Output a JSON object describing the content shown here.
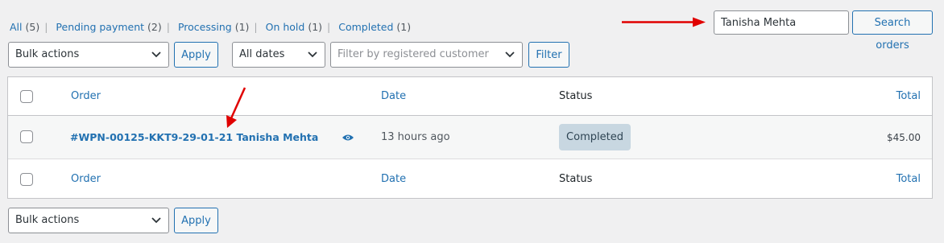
{
  "status_filters": [
    {
      "label": "All",
      "count": "(5)"
    },
    {
      "label": "Pending payment",
      "count": "(2)"
    },
    {
      "label": "Processing",
      "count": "(1)"
    },
    {
      "label": "On hold",
      "count": "(1)"
    },
    {
      "label": "Completed",
      "count": "(1)"
    }
  ],
  "search": {
    "value": "Tanisha Mehta",
    "button_label": "Search orders"
  },
  "top_actions": {
    "bulk_select": "Bulk actions",
    "apply_label": "Apply",
    "dates_select": "All dates",
    "customer_placeholder": "Filter by registered customer",
    "filter_label": "Filter"
  },
  "table": {
    "columns": {
      "order": "Order",
      "date": "Date",
      "status": "Status",
      "total": "Total"
    },
    "rows": [
      {
        "order": "#WPN-00125-KKT9-29-01-21 Tanisha Mehta",
        "date": "13 hours ago",
        "status": "Completed",
        "total": "$45.00"
      }
    ]
  },
  "bottom_actions": {
    "bulk_select": "Bulk actions",
    "apply_label": "Apply"
  },
  "icons": {
    "preview": "eye-icon",
    "dropdown": "chevron-down-icon",
    "annotation": "red-arrow"
  },
  "colors": {
    "link": "#2271b1",
    "annotation": "#e00000",
    "status_completed_bg": "#c8d7e1"
  }
}
